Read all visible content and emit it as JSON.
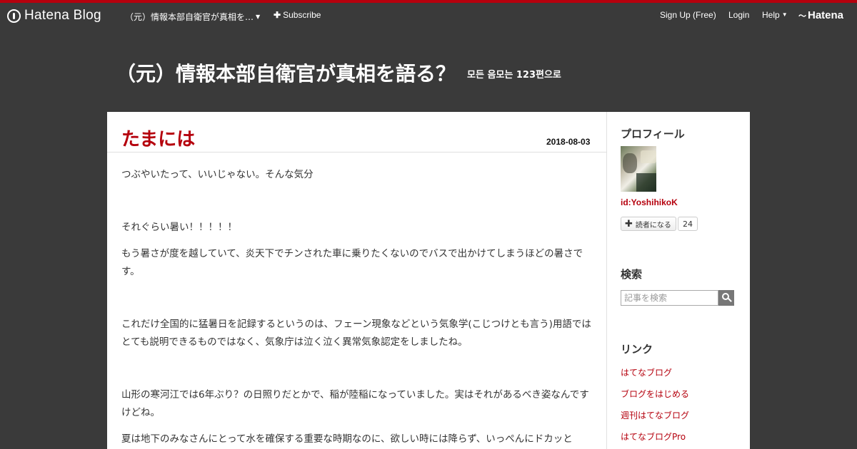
{
  "globalbar": {
    "brand_label": "Hatena Blog",
    "blog_menu_label": "（元）情報本部自衛官が真相を…",
    "subscribe_label": "Subscribe",
    "signup_label": "Sign Up (Free)",
    "login_label": "Login",
    "help_label": "Help",
    "hatena_label": "Hatena"
  },
  "blog": {
    "title": "（元）情報本部自衛官が真相を語る？",
    "description": "모든 음모는 123편으로"
  },
  "entry": {
    "title": "たまには",
    "date": "2018-08-03",
    "paragraphs": [
      "つぶやいたって、いいじゃない。そんな気分",
      "それぐらい暑い！！！！！",
      "もう暑さが度を越していて、炎天下でチンされた車に乗りたくないのでバスで出かけてしまうほどの暑さです。",
      "これだけ全国的に猛暑日を記録するというのは、フェーン現象などという気象学(こじつけとも言う)用語ではとても説明できるものではなく、気象庁は泣く泣く異常気象認定をしましたね。",
      "山形の寒河江では6年ぶり？の日照りだとかで、稲が陸稲になっていました。実はそれがあるべき姿なんですけどね。",
      "夏は地下のみなさんにとって水を確保する重要な時期なのに、欲しい時には降らず、いっぺんにドカッと"
    ]
  },
  "sidebar": {
    "profile_heading": "プロフィール",
    "profile_id": "id:YoshihikoK",
    "follow_label": "読者になる",
    "follow_count": "24",
    "search_heading": "検索",
    "search_placeholder": "記事を検索",
    "links_heading": "リンク",
    "links": [
      "はてなブログ",
      "ブログをはじめる",
      "週刊はてなブログ",
      "はてなブログPro"
    ]
  },
  "colors": {
    "accent": "#b5000d",
    "header_bg": "#3a3a3a",
    "content_bg": "#ffffff",
    "text": "#333333"
  },
  "icons": [
    "hatena-blog-logo-icon",
    "caret-down-icon",
    "plus-icon",
    "search-icon",
    "hatena-logo-icon"
  ]
}
